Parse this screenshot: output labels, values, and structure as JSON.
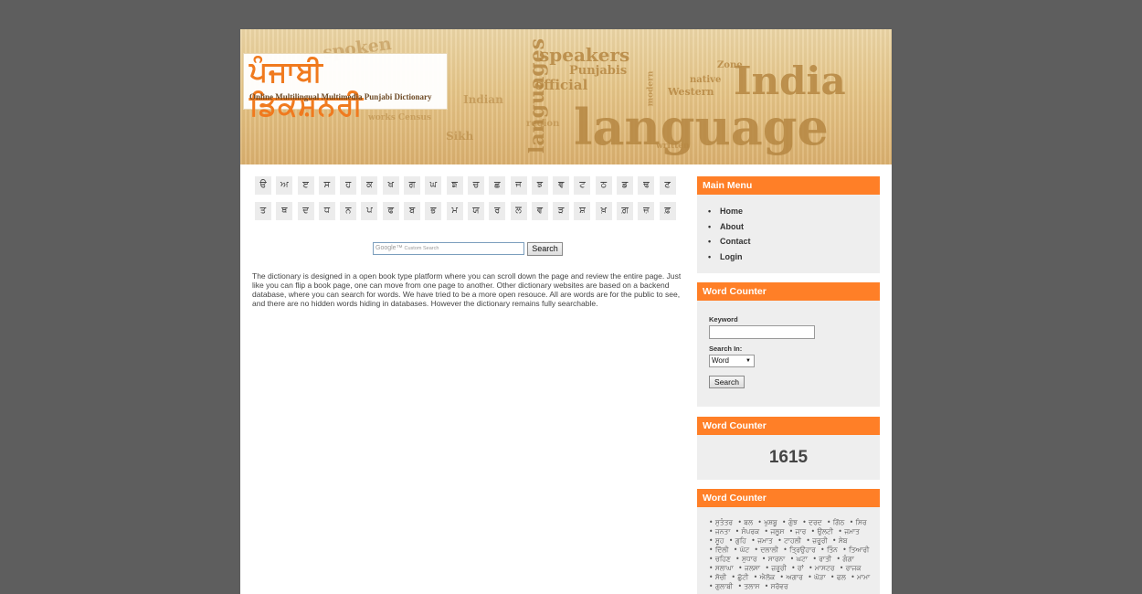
{
  "header": {
    "logo_title": "ਪੰਜਾਬੀ ਡਿਕਸ਼ਨਰੀ",
    "logo_subtitle": "Online Multilingual Multimedia Punjabi Dictionary",
    "banner_words": [
      "spoken",
      "speakers",
      "languages",
      "Punjabis",
      "official",
      "India",
      "language",
      "Indian",
      "region",
      "works Census",
      "Western",
      "native",
      "Zone",
      "Sikh",
      "written",
      "modern"
    ]
  },
  "letters": {
    "row1": [
      "ੳ",
      "ਅ",
      "ੲ",
      "ਸ",
      "ਹ",
      "ਕ",
      "ਖ",
      "ਗ",
      "ਘ",
      "ਙ",
      "ਚ",
      "ਛ",
      "ਜ",
      "ਝ",
      "ਞ",
      "ਟ",
      "ਠ",
      "ਡ",
      "ਢ",
      "ਣ"
    ],
    "row2": [
      "ਤ",
      "ਥ",
      "ਦ",
      "ਧ",
      "ਨ",
      "ਪ",
      "ਫ",
      "ਬ",
      "ਭ",
      "ਮ",
      "ਯ",
      "ਰ",
      "ਲ",
      "ਵ",
      "ੜ",
      "ਸ਼",
      "ਖ਼",
      "ਗ਼",
      "ਜ਼",
      "ਫ਼"
    ]
  },
  "search": {
    "placeholder": "Custom Search",
    "google_mark": "Google™",
    "button_label": "Search"
  },
  "description": "The dictionary is designed in a open book type platform where you can scroll down the page and review the entire page. Just like you can flip a book page, one can move from one page to another. Other dictionary websites are based on a backend database, where you can search for words. We have tried to be a more open resouce. All are words are for the public to see, and there are no hidden words hiding in databases. However the dictionary remains fully searchable.",
  "sidebar": {
    "main_menu": {
      "title": "Main Menu",
      "items": [
        {
          "label": "Home"
        },
        {
          "label": "About"
        },
        {
          "label": "Contact"
        },
        {
          "label": "Login"
        }
      ]
    },
    "search_box": {
      "title": "Word Counter",
      "keyword_label": "Keyword",
      "search_in_label": "Search In:",
      "select_value": "Word",
      "button_label": "Search"
    },
    "counter_box": {
      "title": "Word Counter",
      "count": "1615"
    },
    "cloud_box": {
      "title": "Word Counter",
      "words": [
        "ਸੁਤੰਤਰ",
        "ਬਲ",
        "ਖੁਸ਼ਬੂ",
        "ਗੁੰਝ",
        "ਦਰਦ",
        "ਗਿੱਠ",
        "ਸਿਰ",
        "ਜਨਤਾ",
        "ਸੰਪਰਕ",
        "ਜਲੂਸ",
        "ਜਾਰ",
        "ਉਲਟੀ",
        "ਜਮਾਤ",
        "ਸੂਹ",
        "ਗੁਹਿ",
        "ਜਮਾਤ",
        "ਟਾਹਲੀ",
        "ਜ਼ਰੂਰੀ",
        "ਸੇਬ",
        "ਦਿੱਲੀ",
        "ਘੱਟ",
        "ਦਲਾਲੀ",
        "ਤ੍ਰਿਉਹਾਰ",
        "ਤਿੰਨ",
        "ਤਿਆਰੀ",
        "ਚਹਿਣ",
        "ਸੁਧਾਰ",
        "ਸਾਰਨਾ",
        "ਘਟਾ",
        "ਰਾਤੀ",
        "ਗੰਗਾ",
        "ਸਲਾਘਾ",
        "ਜਲਸਾ",
        "ਜ਼ਰੂਰੀ",
        "ਰਾਂ",
        "ਮਾਸਟਰ",
        "ਰਾਜਕ",
        "ਸੋਚੀ",
        "ਛੁੱਟੀ",
        "ਐਲੋਕ",
        "ਅਗਾਰ",
        "ਘੋੜਾ",
        "ਫਲ",
        "ਮਾਮਾ",
        "ਗੁਲਾਬੀ",
        "ਤਲਾਸ",
        "ਸਰੋਵਰ"
      ]
    }
  }
}
